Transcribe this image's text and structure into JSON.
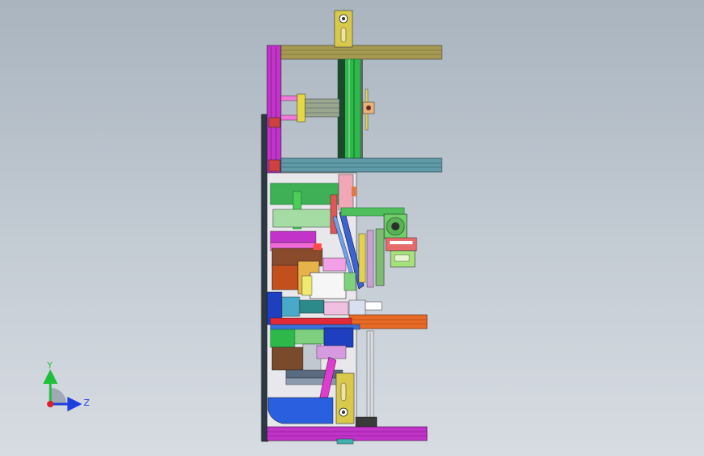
{
  "viewport": {
    "background_top": "#a9b4bf",
    "background_bottom": "#d7dce2",
    "model": "machine-assembly-side-view"
  },
  "triad": {
    "y_label": "Y",
    "z_label": "Z",
    "y_color": "#1fbf3a",
    "z_color": "#1d3fe0",
    "x_color": "#d8202a"
  },
  "colors": {
    "frame": "#2b3540",
    "magenta": "#c233c9",
    "olive": "#a69a52",
    "green": "#2fb84a",
    "teal": "#5f9aa6",
    "red": "#d82a1f",
    "orange": "#e86a25",
    "blue": "#2a4fd8",
    "pink": "#f06ad8",
    "brown": "#8a4a2c",
    "yellow": "#d9d33a",
    "white": "#f3f3f3"
  }
}
